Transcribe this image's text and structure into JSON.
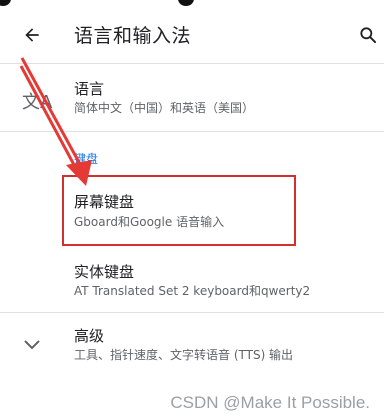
{
  "appbar": {
    "title": "语言和输入法",
    "back_icon": "arrow-back-icon",
    "search_icon": "search-icon"
  },
  "items": {
    "language": {
      "icon": "translate-icon",
      "icon_glyph": "文A",
      "title": "语言",
      "summary": "简体中文（中国）和英语（美国）"
    },
    "section_label": "键盘",
    "onscreen_keyboard": {
      "title": "屏幕键盘",
      "summary": "Gboard和Google 语音输入"
    },
    "physical_keyboard": {
      "title": "实体键盘",
      "summary": "AT Translated Set 2 keyboard和qwerty2"
    },
    "advanced": {
      "icon": "chevron-down-icon",
      "title": "高级",
      "summary": "工具、指针速度、文字转语音 (TTS) 输出"
    }
  },
  "annotation": {
    "highlight_color": "#d32f2f",
    "arrow_color": "#e53935"
  },
  "watermark": "CSDN @Make It Possible."
}
